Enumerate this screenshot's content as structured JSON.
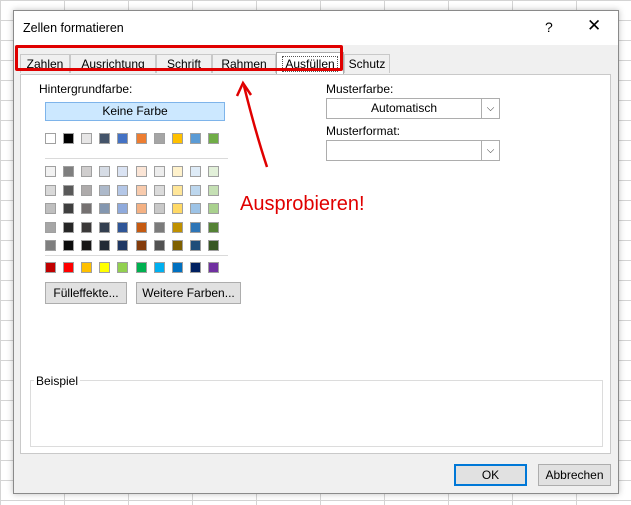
{
  "dialog": {
    "title": "Zellen formatieren",
    "help_glyph": "?",
    "close_glyph": "✕"
  },
  "tabs": [
    {
      "label": "Zahlen",
      "active": false
    },
    {
      "label": "Ausrichtung",
      "active": false
    },
    {
      "label": "Schrift",
      "active": false
    },
    {
      "label": "Rahmen",
      "active": false
    },
    {
      "label": "Ausfüllen",
      "active": true
    },
    {
      "label": "Schutz",
      "active": false
    }
  ],
  "fill": {
    "background_label": "Hintergrundfarbe:",
    "no_color_label": "Keine Farbe",
    "theme_top_row": [
      "#ffffff",
      "#000000",
      "#e7e6e6",
      "#44546a",
      "#4472c4",
      "#ed7d31",
      "#a5a5a5",
      "#ffc000",
      "#5b9bd5",
      "#70ad47"
    ],
    "theme_shades": [
      [
        "#f2f2f2",
        "#7f7f7f",
        "#d0cece",
        "#d6dce5",
        "#dae3f3",
        "#fbe5d6",
        "#ededed",
        "#fff2cc",
        "#deebf7",
        "#e2f0d9"
      ],
      [
        "#d9d9d9",
        "#595959",
        "#aeabab",
        "#adb9ca",
        "#b4c7e7",
        "#f8cbad",
        "#dbdbdb",
        "#ffe699",
        "#bdd7ee",
        "#c5e0b4"
      ],
      [
        "#bfbfbf",
        "#3f3f3f",
        "#757171",
        "#8497b0",
        "#8faadc",
        "#f4b183",
        "#c9c9c9",
        "#ffd966",
        "#9dc3e6",
        "#a9d18e"
      ],
      [
        "#a6a6a6",
        "#262626",
        "#3a3838",
        "#333f50",
        "#2f5597",
        "#c55a11",
        "#7b7b7b",
        "#bf9000",
        "#2e75b6",
        "#548235"
      ],
      [
        "#7f7f7f",
        "#0d0d0d",
        "#171616",
        "#222a35",
        "#1f3864",
        "#843c0c",
        "#525252",
        "#7f6000",
        "#1f4e79",
        "#385723"
      ]
    ],
    "standard_colors": [
      "#c00000",
      "#ff0000",
      "#ffc000",
      "#ffff00",
      "#92d050",
      "#00b050",
      "#00b0f0",
      "#0070c0",
      "#002060",
      "#7030a0"
    ],
    "fill_effects_label": "Fülleffekte...",
    "more_colors_label": "Weitere Farben..."
  },
  "pattern": {
    "color_label": "Musterfarbe:",
    "color_value": "Automatisch",
    "style_label": "Musterformat:",
    "style_value": ""
  },
  "sample": {
    "label": "Beispiel"
  },
  "footer": {
    "ok_label": "OK",
    "cancel_label": "Abbrechen"
  },
  "annotation": {
    "text": "Ausprobieren!",
    "color": "#e00000"
  }
}
